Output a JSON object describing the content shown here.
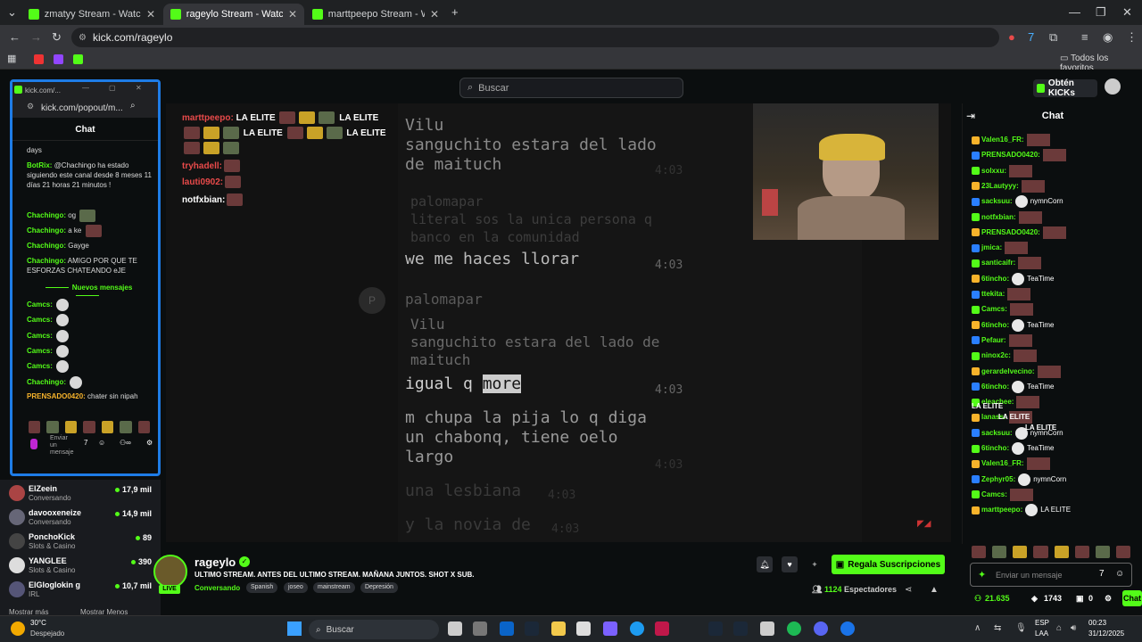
{
  "browser": {
    "tabs": [
      {
        "label": "zmatyy Stream - Watch Live on",
        "active": false
      },
      {
        "label": "rageylo Stream - Watch Live",
        "active": true
      },
      {
        "label": "marttpeepo Stream - Watch Live",
        "active": false
      }
    ],
    "url": "kick.com/rageylo",
    "bookmarks_label": "Todos los favoritos"
  },
  "kick": {
    "search_placeholder": "Buscar",
    "kicks_button": "Obtén KICKs"
  },
  "popout": {
    "window_title": "kick.com/...",
    "url": "kick.com/popout/m...",
    "chat_title": "Chat",
    "messages": [
      {
        "user": "",
        "text": "days"
      },
      {
        "user": "BotRix:",
        "text": "@Chachingo ha estado siguiendo este canal desde 8 meses 11 días 21 horas 21 minutos !"
      },
      {
        "user": "Chachingo:",
        "text": "og"
      },
      {
        "user": "Chachingo:",
        "text": "a ke"
      },
      {
        "user": "Chachingo:",
        "text": "Gayge"
      },
      {
        "user": "Chachingo:",
        "text": "AMIGO POR QUE TE ESFORZAS CHATEANDO eJE"
      }
    ],
    "new_messages": "Nuevos mensajes",
    "after_messages": [
      {
        "user": "Camcs:",
        "text": ""
      },
      {
        "user": "Camcs:",
        "text": ""
      },
      {
        "user": "Camcs:",
        "text": ""
      },
      {
        "user": "Camcs:",
        "text": ""
      },
      {
        "user": "Camcs:",
        "text": ""
      },
      {
        "user": "Chachingo:",
        "text": ""
      },
      {
        "user": "PRENSADO0420:",
        "text": "chater sin nipah"
      }
    ],
    "input_placeholder": "Enviar un mensaje"
  },
  "sidebar": {
    "channels": [
      {
        "name": "ElZeein",
        "category": "Conversando",
        "viewers": "17,9 mil"
      },
      {
        "name": "davooxeneize",
        "category": "Conversando",
        "viewers": "14,9 mil"
      },
      {
        "name": "PonchoKick",
        "category": "Slots & Casino",
        "viewers": "89"
      },
      {
        "name": "YANGLEE",
        "category": "Slots & Casino",
        "viewers": "390"
      },
      {
        "name": "ElGloglokin g",
        "category": "IRL",
        "viewers": "10,7 mil"
      }
    ],
    "show_more": "Mostrar más",
    "show_less": "Mostrar Menos"
  },
  "video": {
    "overlay_chat": [
      {
        "user": "marttpeepo:",
        "text": "LA ELITE"
      },
      {
        "user": "",
        "text": "LA ELITE"
      },
      {
        "user": "tryhadell:",
        "text": ""
      },
      {
        "user": "lauti0902:",
        "text": ""
      },
      {
        "user": "notfxbian:",
        "text": ""
      }
    ],
    "on_screen_lines": [
      "Vilu",
      "sanguchito estara del lado",
      "de maituch",
      "palomapar",
      "literal sos la unica persona q",
      "banco en la comunidad",
      "we me haces llorar",
      "palomapar",
      "Vilu",
      "sanguchito estara del lado de",
      "maituch",
      "igual q",
      "more",
      "m chupa la pija lo q diga",
      "un chabonq, tiene oelo",
      "largo",
      "una lesbiana",
      "y la novia de"
    ],
    "times": [
      "4:03",
      "4:03",
      "4:03",
      "4:03",
      "4:03",
      "4:03"
    ]
  },
  "chat": {
    "title": "Chat",
    "messages": [
      {
        "user": "Valen16_FR:",
        "text": ""
      },
      {
        "user": "PRENSADO0420:",
        "text": ""
      },
      {
        "user": "solxxu:",
        "text": ""
      },
      {
        "user": "23Lautyyy:",
        "text": ""
      },
      {
        "user": "sacksuu:",
        "text": "nymnCorn"
      },
      {
        "user": "notfxbian:",
        "text": ""
      },
      {
        "user": "PRENSADO0420:",
        "text": ""
      },
      {
        "user": "jmica:",
        "text": ""
      },
      {
        "user": "santicaifr:",
        "text": ""
      },
      {
        "user": "6tincho:",
        "text": "TeaTime"
      },
      {
        "user": "ttekita:",
        "text": ""
      },
      {
        "user": "Camcs:",
        "text": ""
      },
      {
        "user": "6tincho:",
        "text": "TeaTime"
      },
      {
        "user": "Pefaur:",
        "text": ""
      },
      {
        "user": "ninox2c:",
        "text": ""
      },
      {
        "user": "gerardelvecino:",
        "text": ""
      },
      {
        "user": "6tincho:",
        "text": "TeaTime"
      },
      {
        "user": "eleachee:",
        "text": ""
      },
      {
        "user": "lanass:",
        "text": ""
      },
      {
        "user": "sacksuu:",
        "text": "nymnCorn"
      },
      {
        "user": "6tincho:",
        "text": "TeaTime"
      },
      {
        "user": "Valen16_FR:",
        "text": ""
      },
      {
        "user": "Zephyr05:",
        "text": "nymnCorn"
      },
      {
        "user": "Camcs:",
        "text": ""
      },
      {
        "user": "marttpeepo:",
        "text": "LA ELITE"
      }
    ],
    "extra_lines": [
      "LA ELITE",
      "LA ELITE",
      "LA ELITE"
    ],
    "input_placeholder": "Enviar un mensaje",
    "points": "21.635",
    "count_a": "1743",
    "count_b": "0",
    "chat_button": "Chat"
  },
  "streamer": {
    "name": "rageylo",
    "live": "LIVE",
    "title": "ULTIMO STREAM. ANTES DEL ULTIMO STREAM. MAÑANA JUNTOS. SHOT X SUB.",
    "category": "Conversando",
    "tags": [
      "Spanish",
      "joseo",
      "mainstream",
      "Depresión"
    ],
    "sub_button": "Regala Suscripciones",
    "viewers": "1124",
    "viewers_label": "Espectadores"
  },
  "taskbar": {
    "weather_temp": "30°C",
    "weather_desc": "Despejado",
    "search": "Buscar",
    "lang1": "ESP",
    "lang2": "LAA",
    "time": "00:23",
    "date": "31/12/2025"
  },
  "colors": {
    "kick_green": "#53fc18",
    "popout_border": "#1e7ce6"
  }
}
